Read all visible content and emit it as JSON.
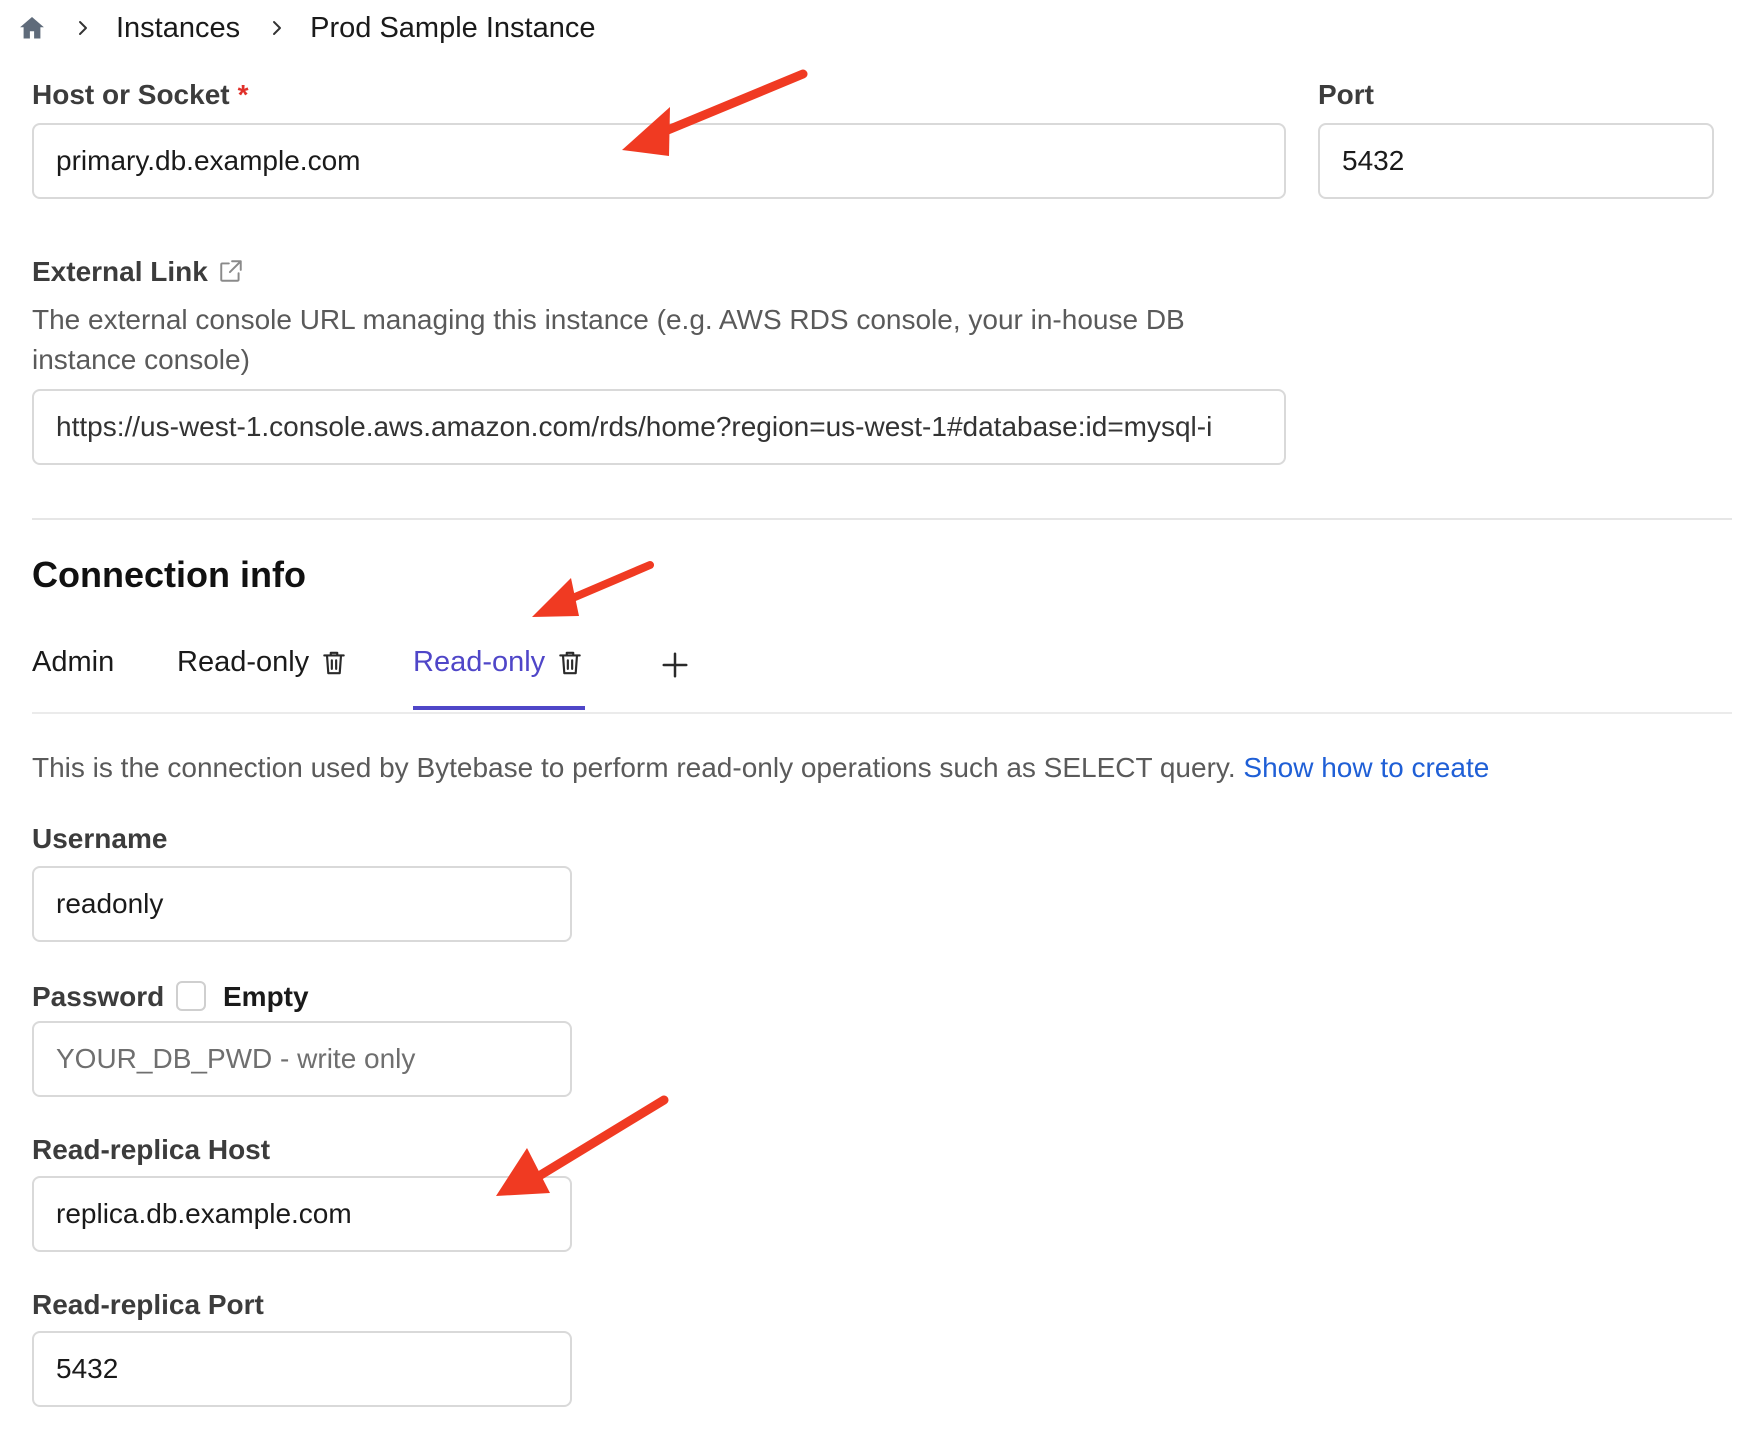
{
  "breadcrumb": {
    "items": [
      "Instances",
      "Prod Sample Instance"
    ]
  },
  "host": {
    "label": "Host or Socket",
    "required_marker": "*",
    "value": "primary.db.example.com"
  },
  "port": {
    "label": "Port",
    "value": "5432"
  },
  "external_link": {
    "label": "External Link",
    "description": "The external console URL managing this instance (e.g. AWS RDS console, your in-house DB instance console)",
    "value": "https://us-west-1.console.aws.amazon.com/rds/home?region=us-west-1#database:id=mysql-i"
  },
  "connection_info": {
    "title": "Connection info",
    "tabs": [
      {
        "label": "Admin",
        "active": false
      },
      {
        "label": "Read-only",
        "active": false
      },
      {
        "label": "Read-only",
        "active": true
      }
    ],
    "description": "This is the connection used by Bytebase to perform read-only operations such as SELECT query.",
    "help_link": "Show how to create"
  },
  "username": {
    "label": "Username",
    "value": "readonly"
  },
  "password": {
    "label": "Password",
    "empty_label": "Empty",
    "placeholder": "YOUR_DB_PWD - write only"
  },
  "replica_host": {
    "label": "Read-replica Host",
    "value": "replica.db.example.com"
  },
  "replica_port": {
    "label": "Read-replica Port",
    "value": "5432"
  },
  "colors": {
    "accent": "#4f46c8",
    "link": "#1f5fd6",
    "required": "#e0302a",
    "annotation_arrow": "#f03a22"
  },
  "icons": [
    "home-icon",
    "chevron-right-icon",
    "external-link-icon",
    "trash-icon",
    "plus-icon",
    "arrow-annotation-icon"
  ]
}
